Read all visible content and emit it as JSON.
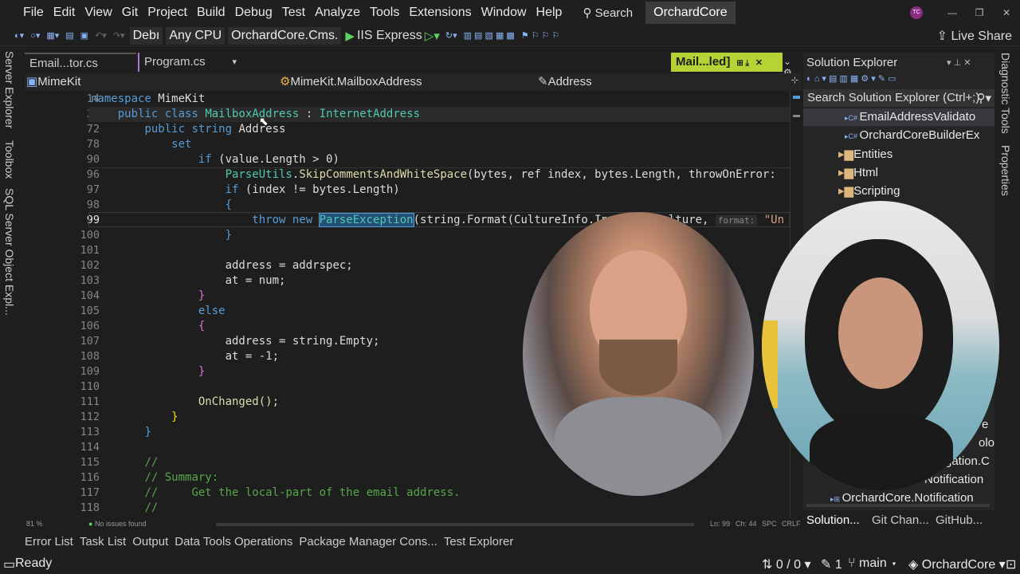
{
  "menu": [
    "File",
    "Edit",
    "View",
    "Git",
    "Project",
    "Build",
    "Debug",
    "Test",
    "Analyze",
    "Tools",
    "Extensions",
    "Window",
    "Help"
  ],
  "search_label": "Search",
  "solution_name": "OrchardCore",
  "user_initials": "TC",
  "toolbar": {
    "config": "Debı",
    "platform": "Any CPU",
    "project": "OrchardCore.Cms.",
    "run_target": "IIS Express",
    "live_share": "Live Share"
  },
  "tabs": {
    "tab1": "Email...tor.cs",
    "tab2": "Program.cs",
    "active": "Mail...led]"
  },
  "nav": {
    "project": "MimeKit",
    "type": "MimeKit.MailboxAddress",
    "member": "Address"
  },
  "left_rail": [
    "Server Explorer",
    "Toolbox",
    "SQL Server Object Expl..."
  ],
  "right_rail": [
    "Diagnostic Tools",
    "Properties"
  ],
  "line_numbers": [
    "14",
    "23",
    "72",
    "78",
    "90",
    "96",
    "97",
    "98",
    "99",
    "100",
    "101",
    "102",
    "103",
    "104",
    "105",
    "106",
    "107",
    "108",
    "109",
    "110",
    "111",
    "112",
    "113",
    "114",
    "115",
    "116",
    "117",
    "118"
  ],
  "code": {
    "ns_kw": "namespace",
    "ns_name": "MimeKit",
    "class_kw": "public class",
    "class_name": "MailboxAddress",
    "class_sep": ":",
    "base_name": "InternetAddress",
    "prop_kw": "public string",
    "prop_name": "Address",
    "set_kw": "set",
    "if_kw": "if",
    "if_cond": "(value.Length > 0)",
    "parse_type": "ParseUtils",
    "parse_call": "SkipCommentsAndWhiteSpace",
    "parse_args": "(bytes, ref index, bytes.Length, throwOnError:",
    "if2_cond": "(index != bytes.Length)",
    "brace_open": "{",
    "brace_close": "}",
    "throw_kw": "throw new",
    "exc": "ParseException",
    "fmt_pre": "(string.Format(CultureInfo.Invariant",
    "fmt_cult": "Culture,",
    "hint": "format:",
    "fmt_str": "\"Un",
    "addr_assign": "address = addrspec;",
    "at_assign": "at = num;",
    "else_kw": "else",
    "addr_empty": "address = string.Empty;",
    "at_neg": "at = -1;",
    "on_changed": "OnChanged();",
    "c1": "//",
    "c2": "// Summary:",
    "c3": "//     Get the local-part of the email address.",
    "c4": "//"
  },
  "editor_status": {
    "zoom": "81 %",
    "issues": "No issues found",
    "ln": "Ln: 99",
    "ch": "Ch: 44",
    "spc": "SPC",
    "crlf": "CRLF"
  },
  "bottom_tabs": [
    "Error List",
    "Task List",
    "Output",
    "Data Tools Operations",
    "Package Manager Cons...",
    "Test Explorer"
  ],
  "status": {
    "ready": "Ready",
    "errors": "0 / 0",
    "pending": "1",
    "branch": "main",
    "repo": "OrchardCore"
  },
  "solution_explorer": {
    "title": "Solution Explorer",
    "search": "Search Solution Explorer (Ctrl+;)",
    "items": [
      "EmailAddressValidato",
      "OrchardCoreBuilderEx",
      "Entities",
      "Html",
      "Scripting",
      "Notification",
      "OrchardCore.Notification"
    ],
    "tabs": [
      "Solution...",
      "Git Chan...",
      "GitHub..."
    ],
    "partial": [
      "e",
      "olo",
      "gation.C"
    ]
  },
  "colors": {
    "accent": "#b5d335",
    "bg": "#1e1e1e",
    "keyword": "#569cd6",
    "type": "#4ec9b0",
    "comment": "#57a64a"
  }
}
